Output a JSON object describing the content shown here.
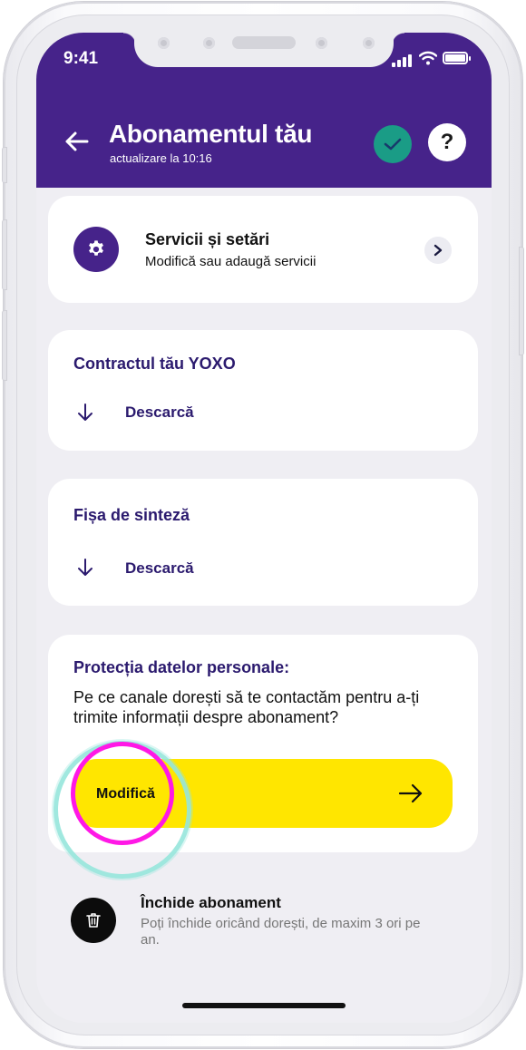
{
  "status_bar": {
    "time": "9:41"
  },
  "header": {
    "title": "Abonamentul tău",
    "subtitle": "actualizare la 10:16",
    "help_label": "?",
    "accent_color": "#46238a"
  },
  "services_card": {
    "title": "Servicii și setări",
    "subtitle": "Modifică sau adaugă servicii",
    "icon": "gear-icon"
  },
  "contract_card": {
    "title": "Contractul tău YOXO",
    "download_label": "Descarcă"
  },
  "summary_card": {
    "title": "Fișa de sinteză",
    "download_label": "Descarcă"
  },
  "privacy_card": {
    "title": "Protecția datelor personale:",
    "body": "Pe ce canale dorești să te contactăm pentru a-ți trimite informații despre abonament?",
    "button_label": "Modifică",
    "button_color": "#ffe600"
  },
  "close_subscription": {
    "title": "Închide abonament",
    "subtitle": "Poți închide oricând dorești, de maxim 3 ori pe an.",
    "icon": "trash-icon"
  },
  "highlight_colors": {
    "inner": "#ff18e6",
    "outer": "#96e6dc"
  }
}
